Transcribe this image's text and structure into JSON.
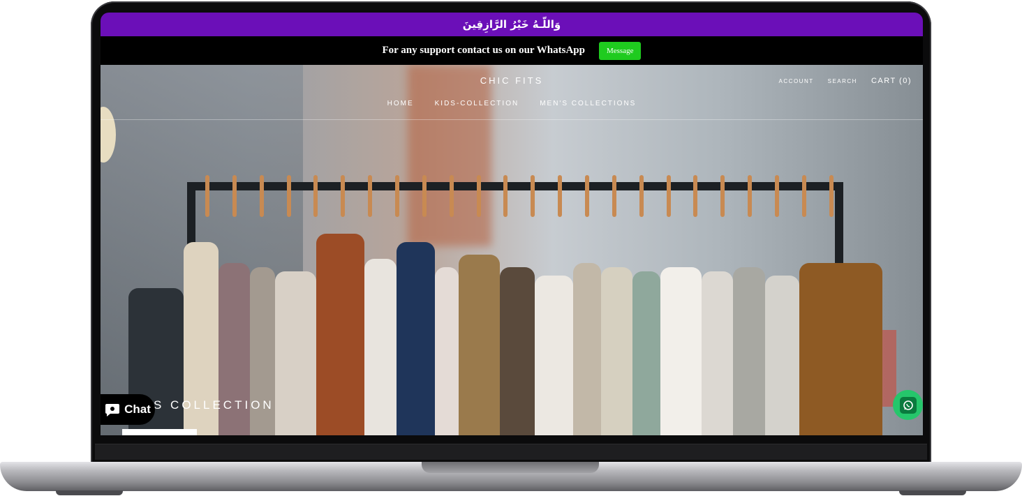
{
  "announcement": {
    "text": "وَاللّـهُ خَيْرُ الرَّازِقِينَ"
  },
  "support_bar": {
    "text": "For any support contact us on our WhatsApp",
    "button_label": "Message",
    "button_color": "#1fcb1f"
  },
  "header": {
    "logo": "CHIC FITS",
    "account": "ACCOUNT",
    "search": "SEARCH",
    "cart": "CART (0)",
    "nav": [
      "HOME",
      "KIDS-COLLECTION",
      "MEN'S COLLECTIONS"
    ]
  },
  "hero": {
    "collection_title": "S COLLECTION"
  },
  "widgets": {
    "chat_label": "Chat",
    "chat_icon": "chat-bubble-icon",
    "whatsapp_icon": "whatsapp-icon",
    "whatsapp_color": "#25c66b"
  },
  "colors": {
    "announcement_bg": "#6b0fb8",
    "support_bg": "#000000"
  }
}
